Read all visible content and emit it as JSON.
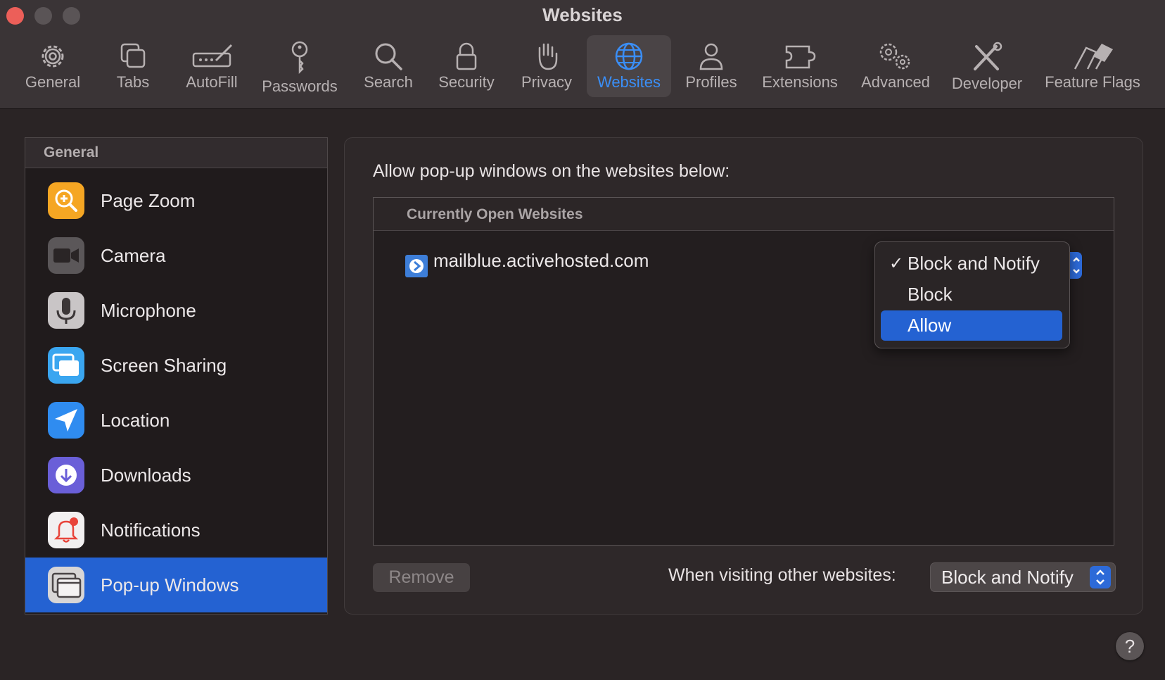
{
  "window": {
    "title": "Websites"
  },
  "toolbar": {
    "items": [
      {
        "label": "General",
        "icon": "gear-icon"
      },
      {
        "label": "Tabs",
        "icon": "tabs-icon"
      },
      {
        "label": "AutoFill",
        "icon": "autofill-pen-icon"
      },
      {
        "label": "Passwords",
        "icon": "key-icon"
      },
      {
        "label": "Search",
        "icon": "magnifier-icon"
      },
      {
        "label": "Security",
        "icon": "lock-icon"
      },
      {
        "label": "Privacy",
        "icon": "hand-icon"
      },
      {
        "label": "Websites",
        "icon": "globe-icon",
        "active": true
      },
      {
        "label": "Profiles",
        "icon": "person-icon"
      },
      {
        "label": "Extensions",
        "icon": "puzzle-icon"
      },
      {
        "label": "Advanced",
        "icon": "gears-icon"
      },
      {
        "label": "Developer",
        "icon": "tools-icon"
      },
      {
        "label": "Feature Flags",
        "icon": "flags-icon"
      }
    ],
    "active_color": "#3a8ef6"
  },
  "sidebar": {
    "header": "General",
    "items": [
      {
        "label": "Page Zoom",
        "icon": "zoom-icon",
        "color": "#f5a623"
      },
      {
        "label": "Camera",
        "icon": "camera-icon",
        "color": "#5b5759"
      },
      {
        "label": "Microphone",
        "icon": "microphone-icon",
        "color": "#c9c5c6"
      },
      {
        "label": "Screen Sharing",
        "icon": "screen-sharing-icon",
        "color": "#3aa6f0"
      },
      {
        "label": "Location",
        "icon": "location-arrow-icon",
        "color": "#2f8cf0"
      },
      {
        "label": "Downloads",
        "icon": "download-icon",
        "color": "#6a5fd8"
      },
      {
        "label": "Notifications",
        "icon": "bell-icon",
        "color": "#f2f0f0"
      },
      {
        "label": "Pop-up Windows",
        "icon": "popup-window-icon",
        "color": "#d8d6d6",
        "selected": true
      }
    ],
    "selection_color": "#2462d2"
  },
  "main": {
    "heading": "Allow pop-up windows on the websites below:",
    "table": {
      "header": "Currently Open Websites",
      "rows": [
        {
          "site": "mailblue.activehosted.com",
          "setting": "Block and Notify"
        }
      ]
    },
    "dropdown_menu": {
      "options": [
        "Block and Notify",
        "Block",
        "Allow"
      ],
      "checked": "Block and Notify",
      "highlighted": "Allow",
      "check_mark": "✓"
    },
    "remove_button": "Remove",
    "other_websites_label": "When visiting other websites:",
    "other_websites_value": "Block and Notify",
    "help_button": "?"
  }
}
